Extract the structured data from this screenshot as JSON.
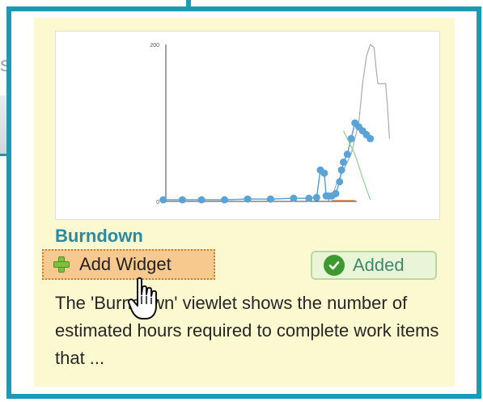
{
  "background": {
    "partial_glyph": "s"
  },
  "widget": {
    "title": "Burndown",
    "add_button_label": "Add Widget",
    "added_label": "Added",
    "description": "The 'Burndown' viewlet shows the number of estimated hours required to complete work items that ..."
  },
  "icons": {
    "add": "plus-icon",
    "added": "check-circle-icon",
    "cursor": "hand-pointer-icon"
  },
  "colors": {
    "frame": "#1b9ab5",
    "card": "#fcf8cf",
    "title": "#2a8aa0",
    "add_button": "#f8c98f",
    "added_badge": "#eaf4d7",
    "check": "#3c9a31"
  },
  "chart_data": {
    "type": "line",
    "yticks": [
      "200",
      "0"
    ],
    "ylim": [
      0,
      200
    ],
    "series": [
      {
        "color": "#aaaaaa",
        "points": [
          [
            0.71,
            1
          ],
          [
            0.72,
            5
          ],
          [
            0.73,
            20
          ],
          [
            0.75,
            40
          ],
          [
            0.77,
            60
          ],
          [
            0.79,
            100
          ],
          [
            0.8,
            150
          ],
          [
            0.81,
            185
          ],
          [
            0.82,
            200
          ],
          [
            0.83,
            196
          ],
          [
            0.835,
            170
          ],
          [
            0.84,
            150
          ],
          [
            0.86,
            150
          ],
          [
            0.865,
            120
          ],
          [
            0.87,
            80
          ]
        ]
      },
      {
        "color": "#5aa3d6",
        "points": [
          [
            0.28,
            2
          ],
          [
            0.33,
            2
          ],
          [
            0.38,
            2
          ],
          [
            0.44,
            2
          ],
          [
            0.5,
            3
          ],
          [
            0.56,
            3
          ],
          [
            0.62,
            4
          ],
          [
            0.66,
            4
          ],
          [
            0.68,
            5
          ],
          [
            0.69,
            40
          ],
          [
            0.7,
            36
          ],
          [
            0.705,
            7
          ],
          [
            0.71,
            7
          ],
          [
            0.72,
            7
          ],
          [
            0.73,
            10
          ],
          [
            0.74,
            25
          ],
          [
            0.745,
            40
          ],
          [
            0.75,
            50
          ],
          [
            0.76,
            60
          ],
          [
            0.77,
            80
          ],
          [
            0.78,
            100
          ],
          [
            0.79,
            95
          ],
          [
            0.8,
            90
          ],
          [
            0.81,
            85
          ],
          [
            0.82,
            80
          ]
        ]
      },
      {
        "color": "#8ed08e",
        "points": [
          [
            0.75,
            90
          ],
          [
            0.78,
            60
          ],
          [
            0.8,
            30
          ],
          [
            0.82,
            2
          ]
        ]
      },
      {
        "color": "#e07a3a",
        "points": [
          [
            0.72,
            1
          ],
          [
            0.78,
            1
          ]
        ]
      }
    ]
  }
}
